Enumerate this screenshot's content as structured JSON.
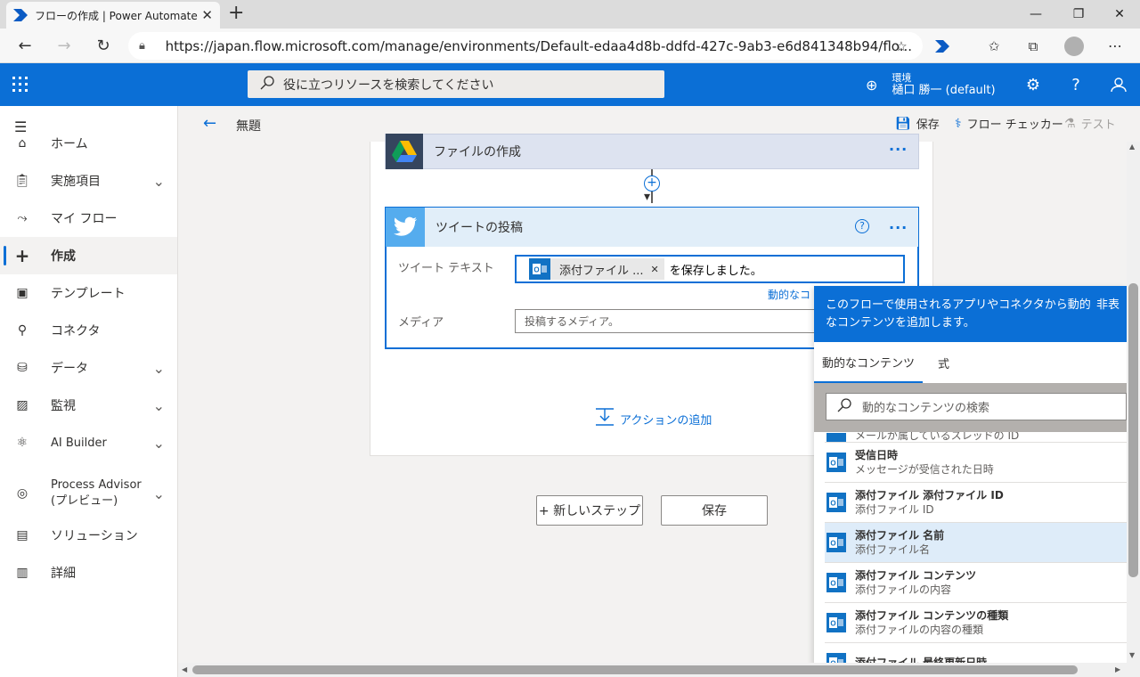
{
  "browser": {
    "tab_title": "フローの作成 | Power Automate",
    "url": "https://japan.flow.microsoft.com/manage/environments/Default-edaa4d8b-ddfd-427c-9ab3-e6d841348b94/flo..."
  },
  "header": {
    "search_placeholder": "役に立つリソースを検索してください",
    "env_label": "環境",
    "env_value": "樋口 勝一 (default)"
  },
  "sidebar": {
    "items": [
      {
        "label": "ホーム",
        "icon": "home-icon"
      },
      {
        "label": "実施項目",
        "icon": "clipboard-icon",
        "expandable": true
      },
      {
        "label": "マイ フロー",
        "icon": "flow-icon"
      },
      {
        "label": "作成",
        "icon": "plus-icon",
        "active": true
      },
      {
        "label": "テンプレート",
        "icon": "template-icon"
      },
      {
        "label": "コネクタ",
        "icon": "connector-icon"
      },
      {
        "label": "データ",
        "icon": "database-icon",
        "expandable": true
      },
      {
        "label": "監視",
        "icon": "chart-icon",
        "expandable": true
      },
      {
        "label": "AI Builder",
        "icon": "ai-icon",
        "expandable": true
      },
      {
        "label": "Process Advisor\n(プレビュー)",
        "icon": "process-icon",
        "expandable": true
      },
      {
        "label": "ソリューション",
        "icon": "solution-icon"
      },
      {
        "label": "詳細",
        "icon": "book-icon"
      }
    ]
  },
  "commandbar": {
    "title": "無題",
    "save": "保存",
    "checker": "フロー チェッカー",
    "test": "テスト"
  },
  "flow": {
    "card1_title": "ファイルの作成",
    "card2_title": "ツイートの投稿",
    "tweet_label": "ツイート テキスト",
    "token_label": "添付ファイル ...",
    "tweet_rest": "を保存しました。",
    "dynamic_link": "動的なコ",
    "media_label": "メディア",
    "media_placeholder": "投稿するメディア。",
    "add_action": "アクションの追加",
    "new_step": "+ 新しいステップ",
    "save_button": "保存"
  },
  "dynamic_panel": {
    "header": "このフローで使用されるアプリやコネクタから動的なコンテンツを追加します。",
    "header_line1": "このフローで使用されるアプリやコネクタから動的",
    "header_line2": "なコンテンツを追加します。",
    "hide": "非表",
    "tab_dynamic": "動的なコンテンツ",
    "tab_expression": "式",
    "search_placeholder": "動的なコンテンツの検索",
    "partial_item": "メールが属しているスレッドの ID",
    "items": [
      {
        "title": "受信日時",
        "sub": "メッセージが受信された日時"
      },
      {
        "title": "添付ファイル 添付ファイル ID",
        "sub": "添付ファイル ID"
      },
      {
        "title": "添付ファイル 名前",
        "sub": "添付ファイル名",
        "selected": true
      },
      {
        "title": "添付ファイル コンテンツ",
        "sub": "添付ファイルの内容"
      },
      {
        "title": "添付ファイル コンテンツの種類",
        "sub": "添付ファイルの内容の種類"
      },
      {
        "title": "添付ファイル 最終更新日時",
        "sub": ""
      }
    ]
  }
}
